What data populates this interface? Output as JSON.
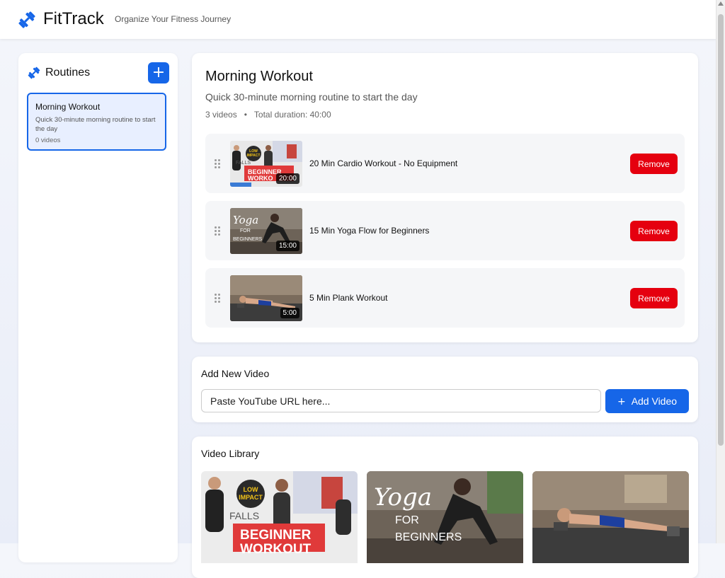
{
  "header": {
    "brand_icon": "dumbbell-icon",
    "title": "FitTrack",
    "tagline": "Organize Your Fitness Journey"
  },
  "sidebar": {
    "icon": "dumbbell-icon",
    "title": "Routines",
    "add_button_label": "+",
    "routines": [
      {
        "name": "Morning Workout",
        "description": "Quick 30-minute morning routine to start the day",
        "count": "0 videos"
      }
    ]
  },
  "routine": {
    "title": "Morning Workout",
    "description": "Quick 30-minute morning routine to start the day",
    "video_count": "3 videos",
    "separator": "•",
    "total_duration": "Total duration: 40:00",
    "videos": [
      {
        "title": "20 Min Cardio Workout - No Equipment",
        "duration": "20:00",
        "remove_label": "Remove",
        "thumb_text_1": "LOW",
        "thumb_text_2": "IMPACT",
        "thumb_text_3": "BEGINNER",
        "thumb_text_4": "WORKO",
        "thumb_text_5": "FALLS"
      },
      {
        "title": "15 Min Yoga Flow for Beginners",
        "duration": "15:00",
        "remove_label": "Remove",
        "thumb_text_1": "Yoga",
        "thumb_text_2": "FOR",
        "thumb_text_3": "BEGINNERS"
      },
      {
        "title": "5 Min Plank Workout",
        "duration": "5:00",
        "remove_label": "Remove"
      }
    ]
  },
  "add_video": {
    "title": "Add New Video",
    "placeholder": "Paste YouTube URL here...",
    "button_label": "Add Video",
    "button_icon": "plus-icon"
  },
  "library": {
    "title": "Video Library",
    "items": [
      {
        "thumb_text_1": "LOW",
        "thumb_text_2": "IMPACT",
        "thumb_text_3": "BEGINNER",
        "thumb_text_4": "WORKOUT",
        "thumb_text_5": "FALLS"
      },
      {
        "thumb_text_1": "Yoga",
        "thumb_text_2": "FOR",
        "thumb_text_3": "BEGINNERS"
      },
      {}
    ]
  },
  "colors": {
    "primary": "#1666e8",
    "danger": "#e5000f",
    "selected_bg": "#e8efff"
  }
}
